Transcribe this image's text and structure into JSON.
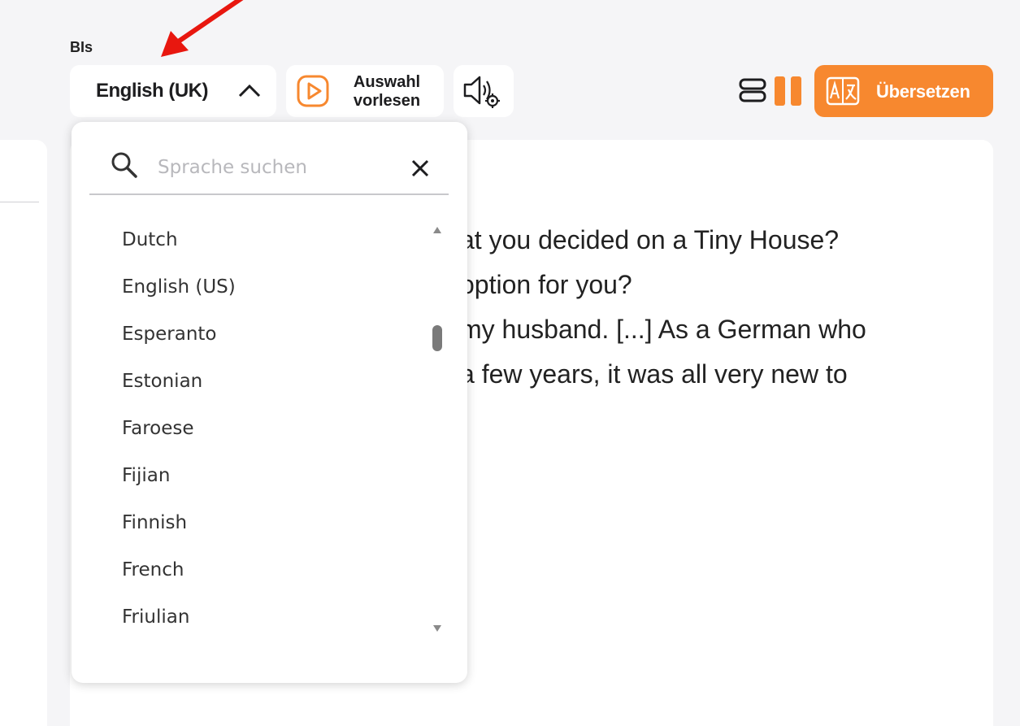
{
  "toolbar": {
    "target_label": "BIs",
    "selected_language": "English (UK)",
    "read_selection_line1": "Auswahl",
    "read_selection_line2": "vorlesen",
    "translate_label": "Übersetzen",
    "accent_color": "#f7882f"
  },
  "dropdown": {
    "search_placeholder": "Sprache suchen",
    "languages": [
      "Dutch",
      "English (US)",
      "Esperanto",
      "Estonian",
      "Faroese",
      "Fijian",
      "Finnish",
      "French",
      "Friulian"
    ]
  },
  "content": {
    "lines": [
      "at you decided on a Tiny House?",
      "option for you?",
      "my husband. [...] As a German who",
      "a few years, it was all very new to"
    ]
  },
  "icons": {
    "search": "search-icon",
    "clear": "close-icon",
    "chevron": "chevron-up-icon",
    "play": "play-icon",
    "speaker_settings": "speaker-settings-icon",
    "layout": "layout-icon",
    "pause": "pause-icon",
    "translate": "translate-icon",
    "annotation_arrow": "red-arrow"
  }
}
